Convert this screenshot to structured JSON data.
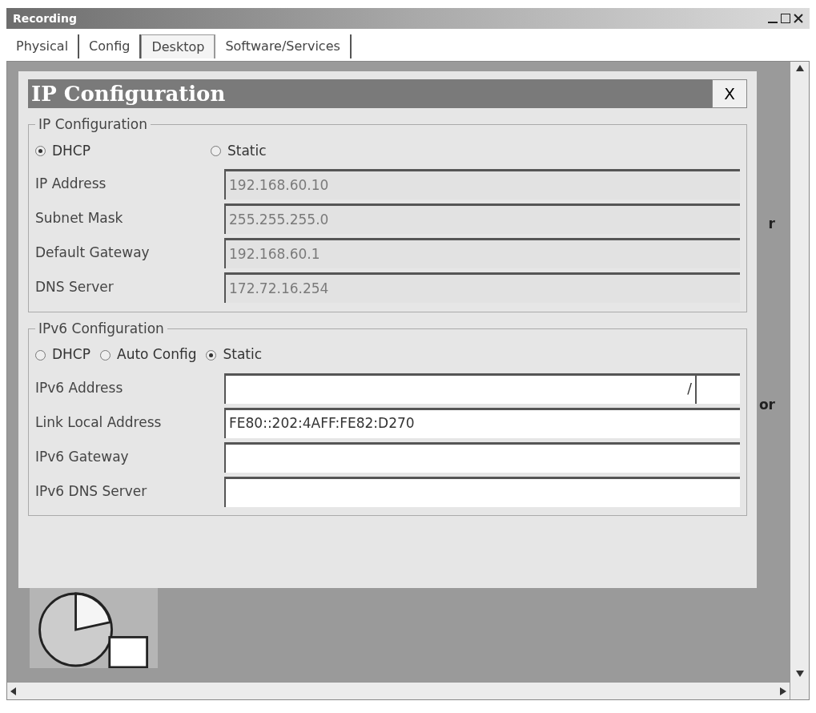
{
  "window": {
    "title": "Recording"
  },
  "tabs": [
    {
      "label": "Physical",
      "selected": false
    },
    {
      "label": "Config",
      "selected": false
    },
    {
      "label": "Desktop",
      "selected": true
    },
    {
      "label": "Software/Services",
      "selected": false
    }
  ],
  "background_texts": [
    "r",
    "or"
  ],
  "dialog": {
    "title": "IP Configuration",
    "close": "X",
    "ipv4": {
      "legend": "IP Configuration",
      "modes": [
        {
          "label": "DHCP",
          "selected": true
        },
        {
          "label": "Static",
          "selected": false
        }
      ],
      "fields": [
        {
          "label": "IP Address",
          "value": "192.168.60.10",
          "disabled": true
        },
        {
          "label": "Subnet Mask",
          "value": "255.255.255.0",
          "disabled": true
        },
        {
          "label": "Default Gateway",
          "value": "192.168.60.1",
          "disabled": true
        },
        {
          "label": "DNS Server",
          "value": "172.72.16.254",
          "disabled": true
        }
      ]
    },
    "ipv6": {
      "legend": "IPv6 Configuration",
      "modes": [
        {
          "label": "DHCP",
          "selected": false
        },
        {
          "label": "Auto Config",
          "selected": false
        },
        {
          "label": "Static",
          "selected": true
        }
      ],
      "fields": [
        {
          "label": "IPv6 Address",
          "kind": "prefix",
          "separator": "/",
          "disabled": false
        },
        {
          "label": "Link Local Address",
          "value": "FE80::202:4AFF:FE82:D270",
          "disabled": false
        },
        {
          "label": "IPv6 Gateway",
          "disabled": false
        },
        {
          "label": "IPv6 DNS Server",
          "disabled": false
        }
      ]
    }
  }
}
